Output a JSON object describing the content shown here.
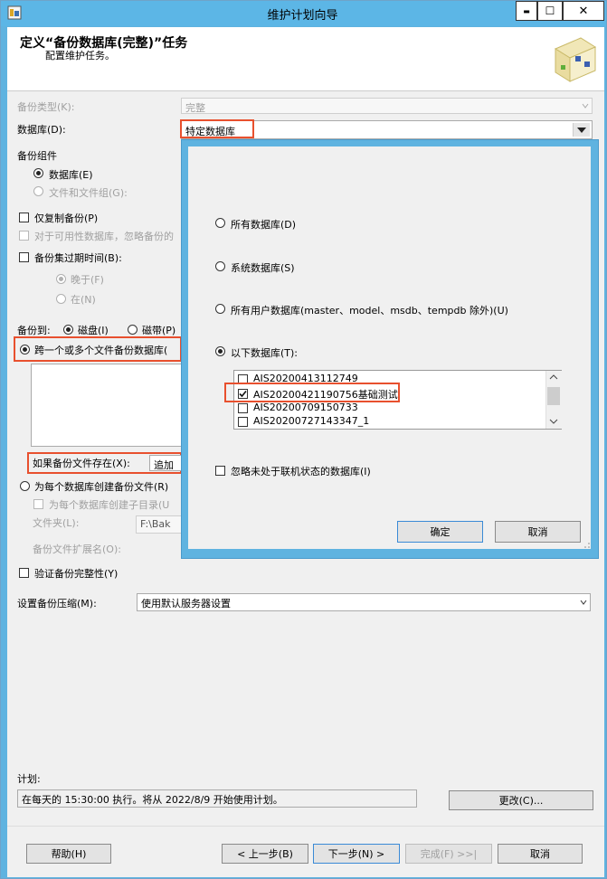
{
  "window": {
    "title": "维护计划向导",
    "min": "▬",
    "max": "☐",
    "close": "✕"
  },
  "header": {
    "title": "定义“备份数据库(完整)”任务",
    "subtitle": "配置维护任务。"
  },
  "form": {
    "backup_type_label": "备份类型(K):",
    "backup_type_value": "完整",
    "database_label": "数据库(D):",
    "database_value": "特定数据库",
    "components_label": "备份组件",
    "component_database": "数据库(E)",
    "component_files": "文件和文件组(G):",
    "copy_only": "仅复制备份(P)",
    "availability_prefix": "对于可用性数据库，忽略备份的",
    "expire_label": "备份集过期时间(B):",
    "after": "晚于(F)",
    "on": "在(N)",
    "backup_to_label": "备份到:",
    "disk": "磁盘(I)",
    "tape": "磁带(P)",
    "span_files": "跨一个或多个文件备份数据库(",
    "if_exists_label": "如果备份文件存在(X):",
    "if_exists_value": "追加",
    "per_db_file": "为每个数据库创建备份文件(R)",
    "per_db_subdir": "为每个数据库创建子目录(U",
    "folder_label": "文件夹(L):",
    "folder_value": "F:\\Bak",
    "ext_label": "备份文件扩展名(O):",
    "verify": "验证备份完整性(Y)",
    "compression_label": "设置备份压缩(M):",
    "compression_value": "使用默认服务器设置",
    "schedule_label": "计划:",
    "schedule_value": "在每天的 15:30:00 执行。将从 2022/8/9 开始使用计划。",
    "change_btn": "更改(C)..."
  },
  "popup": {
    "all_db": "所有数据库(D)",
    "system_db": "系统数据库(S)",
    "user_db": "所有用户数据库(master、model、msdb、tempdb 除外)(U)",
    "these_db": "以下数据库(T):",
    "db_list": [
      {
        "name": "AIS20200413112749",
        "checked": false
      },
      {
        "name": "AIS20200421190756基础测试",
        "checked": true
      },
      {
        "name": "AIS20200709150733",
        "checked": false
      },
      {
        "name": "AIS20200727143347_1",
        "checked": false
      }
    ],
    "ignore_offline": "忽略未处于联机状态的数据库(I)",
    "ok": "确定",
    "cancel": "取消"
  },
  "footer": {
    "help": "帮助(H)",
    "back": "< 上一步(B)",
    "next": "下一步(N) >",
    "finish": "完成(F) >>|",
    "cancel": "取消"
  }
}
